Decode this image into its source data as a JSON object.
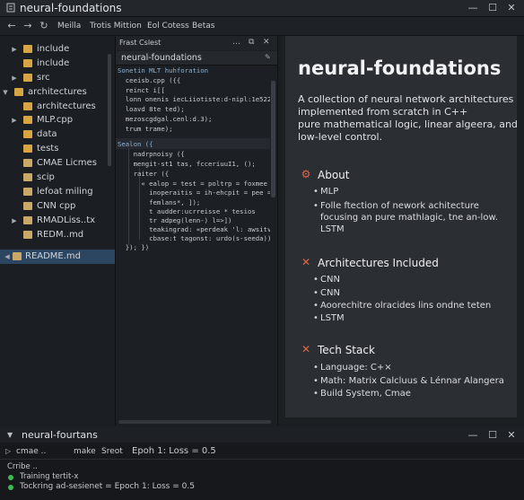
{
  "window": {
    "title": "neural-foundations",
    "controls": {
      "minimize": "—",
      "maximize": "☐",
      "close": "✕"
    }
  },
  "nav": {
    "back": "←",
    "forward": "→",
    "refresh": "↻",
    "menus": [
      "Meilla",
      "Trotis Mittion",
      "Eol Cotess",
      "Betas"
    ]
  },
  "sidebar": {
    "items": [
      {
        "label": "include",
        "kind": "folder",
        "depth": 1,
        "twisty": "▶"
      },
      {
        "label": "include",
        "kind": "folder",
        "depth": 1,
        "twisty": ""
      },
      {
        "label": "src",
        "kind": "folder",
        "depth": 1,
        "twisty": "▶"
      },
      {
        "label": "architectures",
        "kind": "folder",
        "depth": 0,
        "twisty": "▼"
      },
      {
        "label": "architectures",
        "kind": "folder",
        "depth": 1,
        "twisty": ""
      },
      {
        "label": "MLP.cpp",
        "kind": "folder",
        "depth": 1,
        "twisty": "▶"
      },
      {
        "label": "data",
        "kind": "folder",
        "depth": 1,
        "twisty": ""
      },
      {
        "label": "tests",
        "kind": "folder",
        "depth": 1,
        "twisty": ""
      },
      {
        "label": "CMAE Licmes",
        "kind": "file",
        "depth": 1,
        "twisty": ""
      },
      {
        "label": "scip",
        "kind": "file",
        "depth": 1,
        "twisty": ""
      },
      {
        "label": "lefoat miling",
        "kind": "file",
        "depth": 1,
        "twisty": ""
      },
      {
        "label": "CNN cpp",
        "kind": "file",
        "depth": 1,
        "twisty": ""
      },
      {
        "label": "RMADLiss..tx",
        "kind": "file",
        "depth": 1,
        "twisty": "▶"
      },
      {
        "label": "REDM..md",
        "kind": "file",
        "depth": 1,
        "twisty": ""
      }
    ],
    "selected": {
      "label": "README.md",
      "twisty": "◀"
    }
  },
  "editor": {
    "header": "Frast Cslest",
    "header_icons": {
      "more": "…",
      "split": "⧉",
      "close": "✕"
    },
    "tab": "neural-foundations",
    "tab_icon": "✎",
    "code_lines": [
      "Sonetin MLT huhforation",
      "  ceeisb.cpp ({{",
      "  reinct i[[",
      "  lonn onenis iecLiiotiste:d-nipl:1e522);",
      "  loavd 8te ted);",
      "  mezoscgdgal.cenl:d.3);",
      "  trum trame);",
      "",
      "Sealon ({",
      "    nadrpnoisy ({",
      "    mengit-st1 tas, fcceriuuI1, ();",
      "    raiter ({",
      "      « ealop = test = poltrp = foxmee",
      "        inoperaitis = ih-ehcpit = pee = (",
      "        femlans*, ]);",
      "        t audder:ucrreisse * tesios",
      "        tr adpeg(lenn-) l=>])",
      "        teakingrad: «perdeak 'l: awsitvi",
      "        cbase:t tagonst: urdo(s-seeda));",
      "  }); })"
    ]
  },
  "readme": {
    "title": "neural-foundations",
    "description": [
      "A collection of neural network architectures",
      "implemented from scratch in C++",
      "pure mathematical logic, linear algeera, and",
      "low-level control."
    ],
    "sections": [
      {
        "heading": "About",
        "icon": "⚙",
        "icon_color": "#e0684b",
        "bullets": [
          {
            "text": "MLP",
            "cont": false
          },
          {
            "text": "Folle ftection of nework achitecture",
            "cont": false
          },
          {
            "text": "focusing an pure mathlagic, tne an-low.",
            "cont": true
          },
          {
            "text": "LSTM",
            "cont": true
          }
        ]
      },
      {
        "heading": "Architectures Included",
        "icon": "✕",
        "icon_color": "#e0684b",
        "bullets": [
          {
            "text": "CNN",
            "cont": false
          },
          {
            "text": "CNN",
            "cont": false
          },
          {
            "text": "Aoorechitre olracides lins ondne teten",
            "cont": false
          },
          {
            "text": "LSTM",
            "cont": false
          }
        ]
      },
      {
        "heading": "Tech Stack",
        "icon": "✕",
        "icon_color": "#e0684b",
        "bullets": [
          {
            "text": "Language: C+×",
            "cont": false
          },
          {
            "text": "Math: Matrix Calcluus & Lénnar Alangera",
            "cont": false
          },
          {
            "text": "Build System, Cmae",
            "cont": false
          }
        ]
      }
    ]
  },
  "terminal": {
    "title": "neural-fourtans",
    "title_twisty": "▼",
    "win_controls": {
      "minimize": "—",
      "maximize": "☐",
      "close": "✕"
    },
    "tabs": [
      "cmae ..",
      "make",
      "Sreot",
      "Epoh 1: Loss = 0.5"
    ],
    "tab_icon": "▷",
    "lines": [
      "Crribe ..",
      "Training tertit-x",
      "Tockring ad-sesienet = Epoch 1: Loss = 0.5"
    ],
    "status_color": "#3fb950"
  }
}
